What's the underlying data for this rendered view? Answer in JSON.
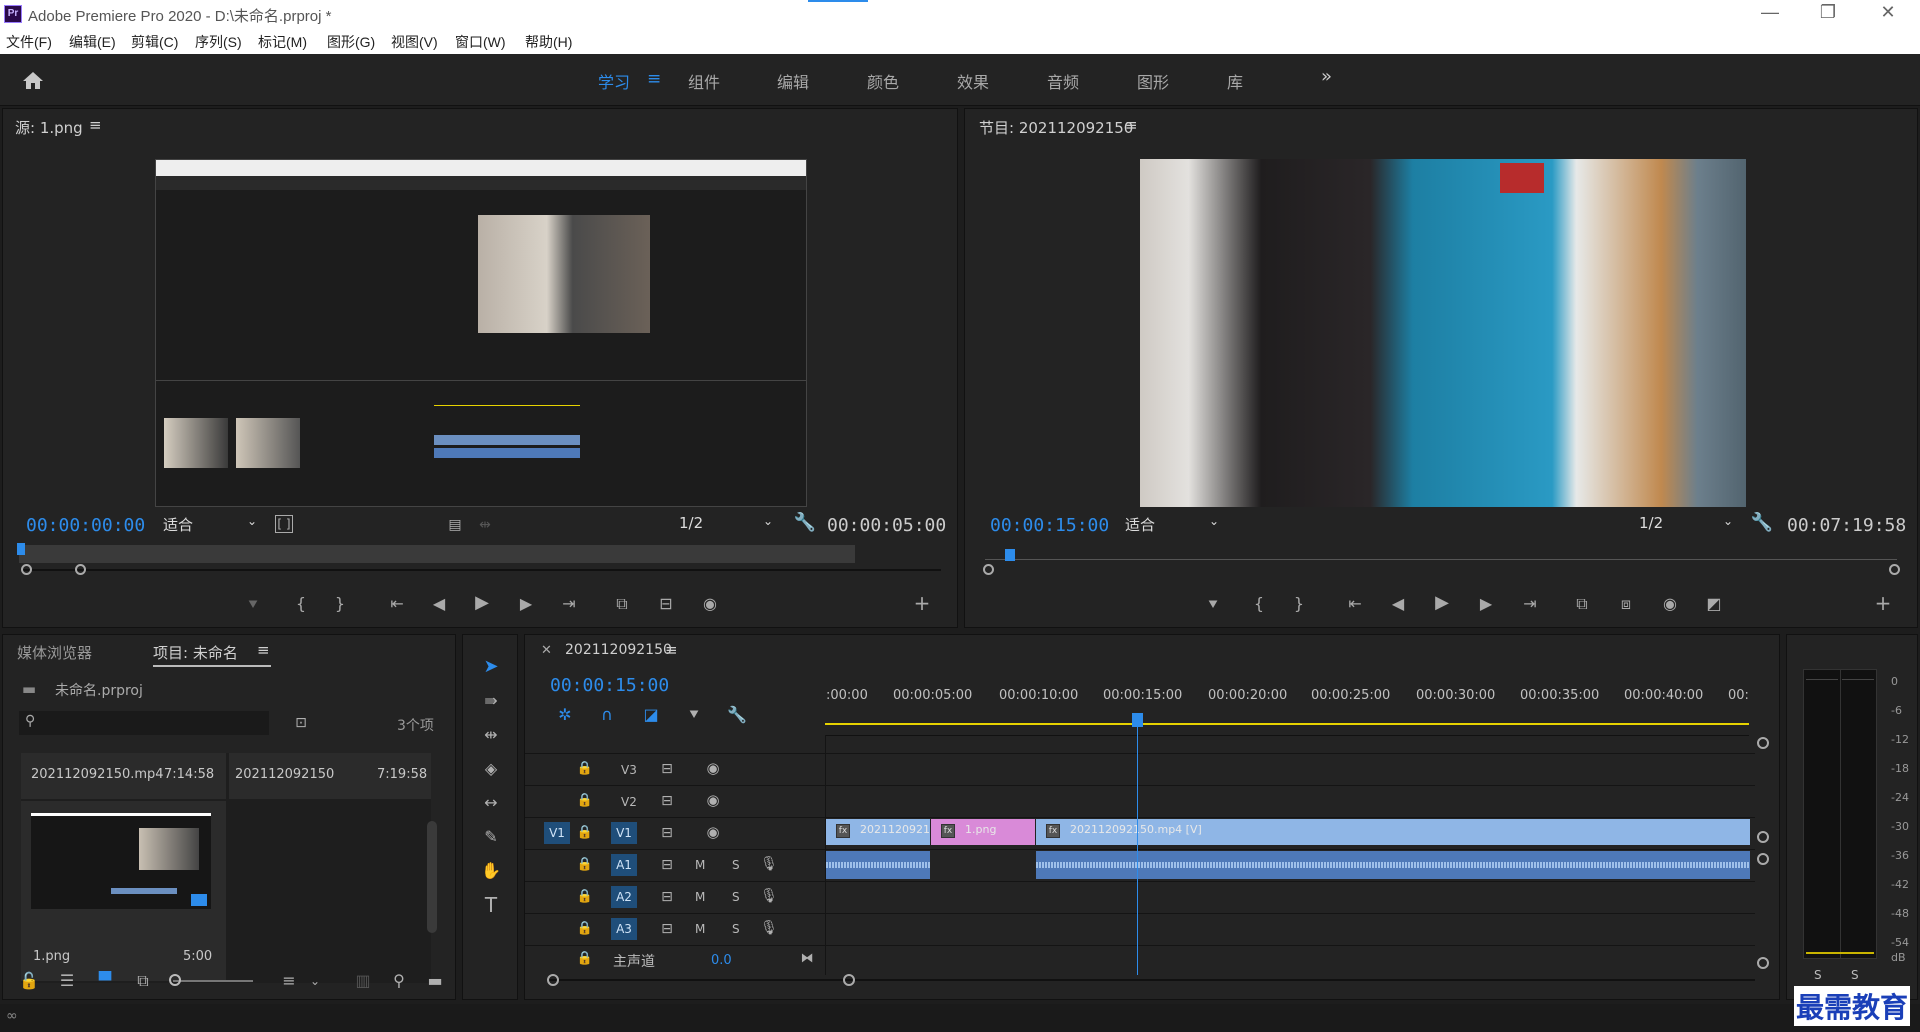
{
  "app": {
    "title": "Adobe Premiere Pro 2020 - D:\\未命名.prproj *",
    "logo": "Pr"
  },
  "menu": [
    "文件(F)",
    "编辑(E)",
    "剪辑(C)",
    "序列(S)",
    "标记(M)",
    "图形(G)",
    "视图(V)",
    "窗口(W)",
    "帮助(H)"
  ],
  "workspaces": [
    "学习",
    "组件",
    "编辑",
    "颜色",
    "效果",
    "音频",
    "图形",
    "库"
  ],
  "workspace_overflow": "»",
  "source": {
    "title": "源: 1.png",
    "timecode": "00:00:00:00",
    "fit": "适合",
    "resolution": "1/2",
    "duration": "00:00:05:00"
  },
  "program": {
    "title": "节目: 202112092150",
    "timecode": "00:00:15:00",
    "fit": "适合",
    "resolution": "1/2",
    "duration": "00:07:19:58"
  },
  "project": {
    "tab_media": "媒体浏览器",
    "tab_project": "项目: 未命名",
    "file": "未命名.prproj",
    "search_placeholder": "",
    "count": "3个项",
    "items": [
      {
        "name": "202112092150.mp4",
        "dur": "7:14:58"
      },
      {
        "name": "202112092150",
        "dur": "7:19:58"
      },
      {
        "name": "1.png",
        "dur": "5:00"
      }
    ]
  },
  "timeline": {
    "tab": "202112092150",
    "timecode": "00:00:15:00",
    "ruler": [
      ":00:00",
      "00:00:05:00",
      "00:00:10:00",
      "00:00:15:00",
      "00:00:20:00",
      "00:00:25:00",
      "00:00:30:00",
      "00:00:35:00",
      "00:00:40:00",
      "00:"
    ],
    "tracks": [
      "V3",
      "V2",
      "V1",
      "A1",
      "A2",
      "A3"
    ],
    "target_video": "V1",
    "mute": "M",
    "solo": "S",
    "master": {
      "label": "主声道",
      "value": "0.0"
    },
    "clips": [
      {
        "label": "2021120921"
      },
      {
        "label": "1.png"
      },
      {
        "label": "202112092150.mp4 [V]"
      }
    ]
  },
  "meter": {
    "scale": [
      "0",
      "-6",
      "-12",
      "-18",
      "-24",
      "-30",
      "-36",
      "-42",
      "-48",
      "-54",
      "dB"
    ],
    "solo": [
      "S",
      "S"
    ]
  },
  "watermark": "最需教育",
  "colors": {
    "accent": "#2d8ceb",
    "clip_video": "#8fb6e6",
    "clip_image": "#d98ad8",
    "audio": "#4e79b8"
  }
}
